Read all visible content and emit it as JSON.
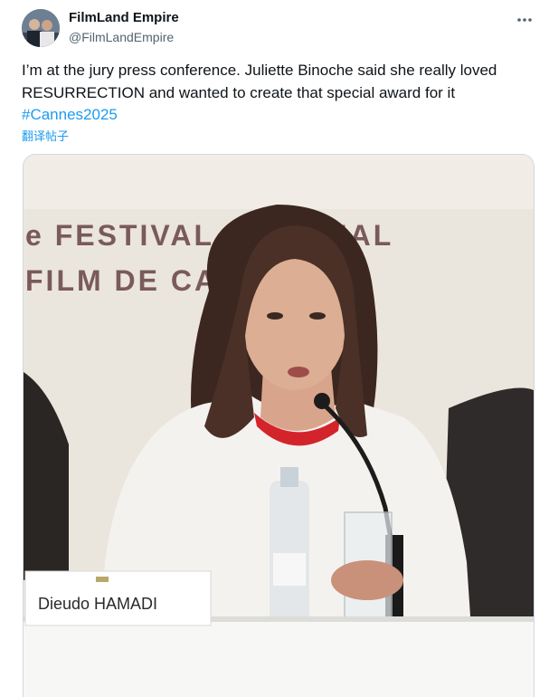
{
  "author": {
    "name": "FilmLand Empire",
    "handle": "@FilmLandEmpire"
  },
  "tweet": {
    "text_line1": "I’m at the jury press conference. Juliette Binoche said she really loved",
    "text_line2": "RESURRECTION and wanted to create that special award for it",
    "hashtag": "#Cannes2025",
    "translate_label": "翻译帖子"
  },
  "photo": {
    "backdrop_line1": "e FESTIVAL IN  TIONAL",
    "backdrop_line2": "FILM DE CA",
    "name_card": "Dieudo HAMADI"
  },
  "icons": {
    "more": "more-horizontal-icon"
  },
  "colors": {
    "link": "#1d9bf0",
    "text": "#0f1419",
    "secondary": "#536471",
    "backdrop_text": "#7a5a5a"
  }
}
